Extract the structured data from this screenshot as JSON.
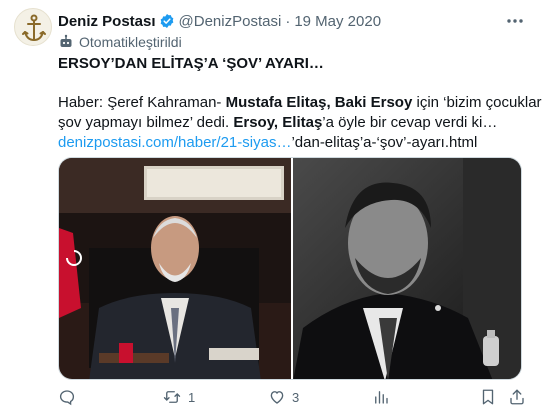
{
  "account": {
    "name": "Deniz Postası",
    "handle": "@DenizPostasi",
    "separator": "·",
    "date": "19 May 2020",
    "automated_label": "Otomatikleştirildi"
  },
  "tweet": {
    "headline_bold": "ERSOY",
    "headline_rest": "’DAN ELİTAŞ’A ‘ŞOV’ AYARI…",
    "line1_a": "Haber: Şeref Kahraman- ",
    "line1_b": "Mustafa Elitaş, Baki Ersoy",
    "line1_c": " için ‘bizim çocuklar",
    "line2_a": "şov yapmayı bilmez’ dedi. ",
    "line2_b": "Ersoy, Elitaş",
    "line2_c": "’a öyle bir cevap verdi ki…",
    "link_text": "denizpostasi.com/haber/21-siyas…",
    "link_rest": "’dan-elitaş’a-‘şov’-ayarı.html"
  },
  "actions": {
    "reply_count": "",
    "retweet_count": "1",
    "like_count": "3",
    "views_count": ""
  },
  "colors": {
    "link": "#1d9bf0",
    "verified": "#1d9bf0",
    "muted": "#536471"
  }
}
